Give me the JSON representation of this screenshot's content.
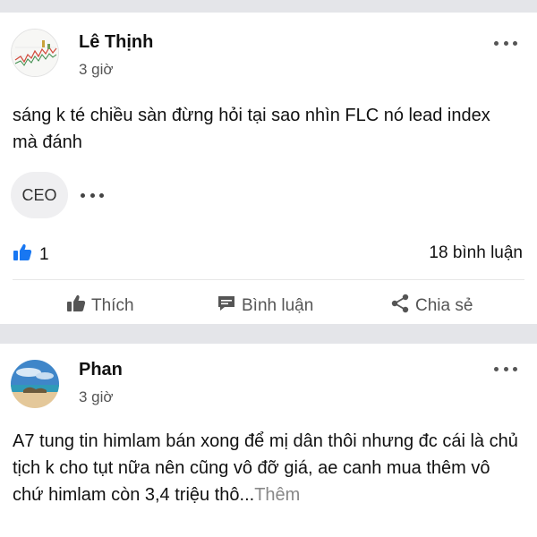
{
  "posts": [
    {
      "author": "Lê Thịnh",
      "time": "3 giờ",
      "text": "sáng k té chiều sàn đừng hỏi tại sao nhìn FLC nó lead index mà đánh",
      "tag": "CEO",
      "likes": "1",
      "comments": "18 bình luận",
      "actions": {
        "like": "Thích",
        "comment": "Bình luận",
        "share": "Chia sẻ"
      }
    },
    {
      "author": "Phan",
      "time": "3 giờ",
      "text": "A7 tung tin himlam bán xong để mị dân thôi nhưng đc cái là chủ tịch k cho tụt nữa nên cũng vô đỡ giá, ae canh mua thêm vô chứ himlam còn 3,4 triệu thô...",
      "more_label": "Thêm"
    }
  ],
  "colors": {
    "like_blue": "#1877f2",
    "background": "#e4e5e9",
    "muted_text": "#555555"
  },
  "icons": [
    "more-dots-icon",
    "thumbs-up-icon",
    "comment-icon",
    "share-icon"
  ]
}
